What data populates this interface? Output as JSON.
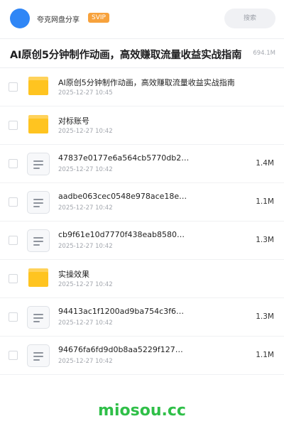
{
  "header": {
    "app_name": "夸克网盘分享",
    "badge": "SVIP",
    "search_placeholder": "搜索"
  },
  "share": {
    "title": "AI原创5分钟制作动画，高效赚取流量收益实战指南",
    "total_size": "694.1M"
  },
  "files": [
    {
      "type": "folder",
      "name": "AI原创5分钟制作动画，高效赚取流量收益实战指南",
      "date": "2025-12-27 10:45",
      "size": ""
    },
    {
      "type": "folder",
      "name": "对标账号",
      "date": "2025-12-27 10:42",
      "size": ""
    },
    {
      "type": "file",
      "name": "47837e0177e6a564cb5770db2…",
      "date": "2025-12-27 10:42",
      "size": "1.4M"
    },
    {
      "type": "file",
      "name": "aadbe063cec0548e978ace18e…",
      "date": "2025-12-27 10:42",
      "size": "1.1M"
    },
    {
      "type": "file",
      "name": "cb9f61e10d7770f438eab8580…",
      "date": "2025-12-27 10:42",
      "size": "1.3M"
    },
    {
      "type": "folder",
      "name": "实操效果",
      "date": "2025-12-27 10:42",
      "size": ""
    },
    {
      "type": "file",
      "name": "94413ac1f1200ad9ba754c3f6…",
      "date": "2025-12-27 10:42",
      "size": "1.3M"
    },
    {
      "type": "file",
      "name": "94676fa6fd9d0b8aa5229f127…",
      "date": "2025-12-27 10:42",
      "size": "1.1M"
    }
  ],
  "watermark": "miosou.cc",
  "colors": {
    "accent": "#2f86f6",
    "svip": "#f7a23c",
    "folder": "#ffc420",
    "watermark": "#2fbf48"
  }
}
